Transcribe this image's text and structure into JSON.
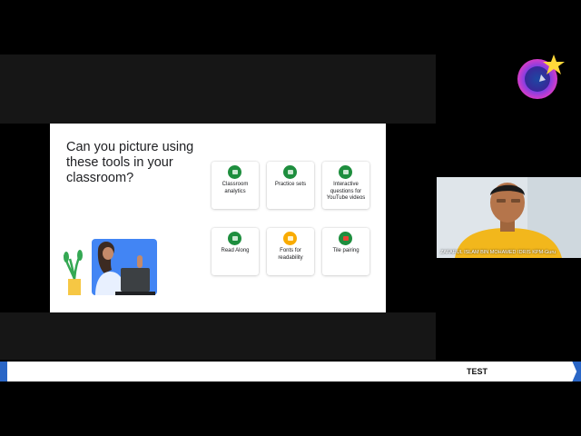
{
  "slide": {
    "title": "Can you picture using these tools in your classroom?",
    "cards": [
      {
        "label": "Classroom analytics",
        "icon": "analytics-icon",
        "color": "#1e8e3e"
      },
      {
        "label": "Practice sets",
        "icon": "practice-sets-icon",
        "color": "#1e8e3e"
      },
      {
        "label": "Interactive questions for YouTube videos",
        "icon": "interactive-questions-icon",
        "color": "#1e8e3e"
      },
      {
        "label": "Read Along",
        "icon": "read-along-icon",
        "color": "#1e8e3e"
      },
      {
        "label": "Fonts for readability",
        "icon": "fonts-icon",
        "color": "#f9ab00"
      },
      {
        "label": "Tile pairing",
        "icon": "tile-pairing-icon",
        "color": "#1e8e3e"
      }
    ]
  },
  "camera": {
    "name": "ZAFARUL ISLAM BIN MOHAMED IDRIS KPM-Guru"
  },
  "ticker": {
    "text": "TEST"
  },
  "colors": {
    "accent_blue": "#2a66c6",
    "google_green": "#1e8e3e",
    "google_yellow": "#f9ab00"
  }
}
